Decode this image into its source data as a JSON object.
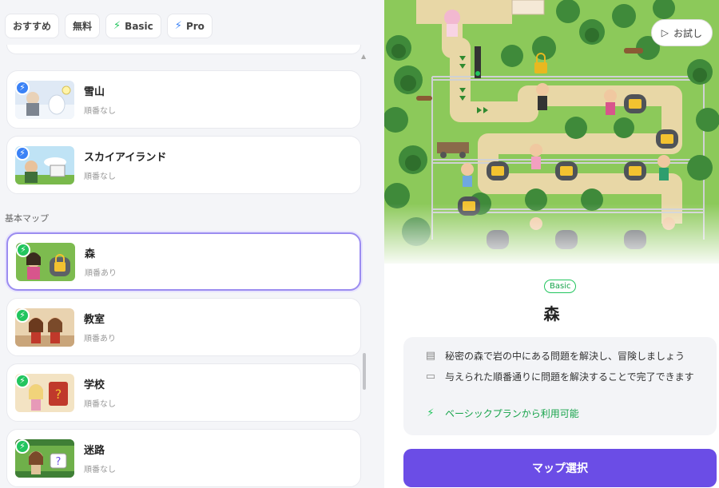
{
  "filters": [
    {
      "label": "おすすめ",
      "icon": ""
    },
    {
      "label": "無料",
      "icon": ""
    },
    {
      "label": "Basic",
      "icon": "bolt-green-icon"
    },
    {
      "label": "Pro",
      "icon": "bolt-blue-icon"
    }
  ],
  "sections": {
    "basic_maps": "基本マップ"
  },
  "cards": [
    {
      "title": "雪山",
      "subtitle": "順番なし",
      "badge": "blue"
    },
    {
      "title": "スカイアイランド",
      "subtitle": "順番なし",
      "badge": "blue"
    },
    {
      "title": "森",
      "subtitle": "順番あり",
      "badge": "green",
      "selected": true
    },
    {
      "title": "教室",
      "subtitle": "順番あり",
      "badge": "green"
    },
    {
      "title": "学校",
      "subtitle": "順番なし",
      "badge": "green"
    },
    {
      "title": "迷路",
      "subtitle": "順番なし",
      "badge": "green"
    }
  ],
  "detail": {
    "try_label": "お試し",
    "tier": "Basic",
    "title": "森",
    "description": "秘密の森で岩の中にある問題を解決し、冒険しましょう",
    "rule": "与えられた順番通りに問題を解決することで完了できます",
    "availability": "ベーシックプランから利用可能",
    "select_label": "マップ選択"
  },
  "colors": {
    "accent": "#6b4de6",
    "basic_green": "#22c55e",
    "pro_blue": "#3b82f6",
    "selected_border": "#9b8cf0"
  }
}
